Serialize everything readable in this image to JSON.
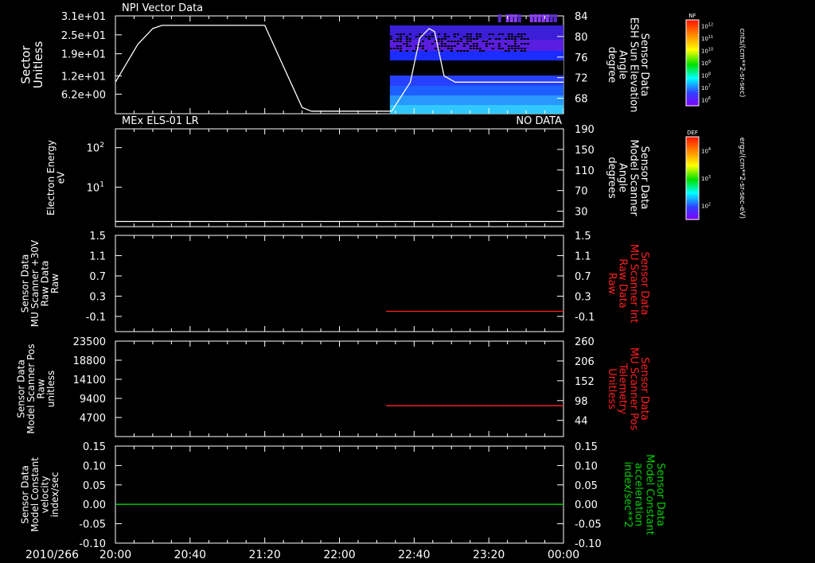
{
  "colors": {
    "background": "#000000",
    "axis": "#ffffff",
    "white_line": "#ffffff",
    "red_line": "#ff2020",
    "green_line": "#00d000",
    "red_label": "#ff2020",
    "green_label": "#00d000"
  },
  "time_axis": {
    "date_label": "2010/266",
    "ticks": [
      "20:00",
      "20:40",
      "21:20",
      "22:00",
      "22:40",
      "23:20",
      "00:00"
    ],
    "range_minutes": [
      0,
      240
    ],
    "minor_step_minutes": 10
  },
  "colorbars": [
    {
      "title": "NF",
      "unit_label": "cnts/(cm**2-sr-sec)",
      "tick_labels": [
        "10^12",
        "10^11",
        "10^10",
        "10^9",
        "10^8",
        "10^7",
        "10^6"
      ],
      "tick_mantissa": "10",
      "tick_exponents": [
        "12",
        "11",
        "10",
        "9",
        "8",
        "7",
        "6"
      ]
    },
    {
      "title": "DEF",
      "unit_label": "ergs/(cm**2-sr-sec-eV)",
      "tick_labels": [
        "10^4",
        "10^3",
        "10^2"
      ],
      "tick_mantissa": "10",
      "tick_exponents": [
        "4",
        "3",
        "2"
      ]
    }
  ],
  "chart_data": [
    {
      "type": "line",
      "title": "NPI Vector Data",
      "ylabel": "Sector\nUnitless",
      "y_ticks": [
        "3.1e+01",
        "2.5e+01",
        "1.9e+01",
        "1.2e+01",
        "6.2e+00"
      ],
      "y_tick_values": [
        31,
        25,
        19,
        12,
        6.2
      ],
      "ylim": [
        0,
        31
      ],
      "y2label": "Sensor Data\nESH Sun Elevation\nAngle\ndegree",
      "y2_ticks": [
        "84",
        "80",
        "76",
        "72",
        "68"
      ],
      "y2_tick_values": [
        84,
        80,
        76,
        72,
        68
      ],
      "y2lim": [
        65,
        84
      ],
      "series": [
        {
          "color": "white",
          "x": [
            0,
            12,
            20,
            25,
            30,
            80,
            90,
            100,
            105,
            148,
            158,
            163,
            168,
            171,
            176,
            182,
            240
          ],
          "y": [
            10,
            22,
            27,
            28,
            28,
            28,
            15,
            2,
            0.8,
            0.8,
            10,
            24,
            27,
            26,
            12,
            10,
            10
          ]
        }
      ],
      "heatmap": {
        "x_range": [
          147,
          240
        ],
        "note_rows": "spectrogram in sector channels"
      }
    },
    {
      "type": "line",
      "title": "MEx ELS-01 LR",
      "status": "NO DATA",
      "ylabel": "Electron Energy\neV",
      "y_ticks": [
        "10^2",
        "10^1"
      ],
      "y_tick_mantissa": "10",
      "y_tick_exponents": [
        "2",
        "1"
      ],
      "y_tick_values": [
        100,
        10
      ],
      "ylim": [
        1,
        300
      ],
      "log_scale": true,
      "y2label": "Sensor Data\nModel Scanner\nAngle\ndegrees",
      "y2_ticks": [
        "190",
        "150",
        "110",
        "70",
        "30"
      ],
      "y2_tick_values": [
        190,
        150,
        110,
        70,
        30
      ],
      "y2lim": [
        0,
        190
      ],
      "series": [
        {
          "color": "white",
          "axis": "y2",
          "x": [
            0,
            240
          ],
          "y": [
            10,
            10
          ]
        }
      ]
    },
    {
      "type": "line",
      "ylabel": "Sensor Data\nMU Scanner +30V\nRaw Data\nRaw",
      "y_ticks": [
        "1.5",
        "1.1",
        "0.7",
        "0.3",
        "-0.1"
      ],
      "y_tick_values": [
        1.5,
        1.1,
        0.7,
        0.3,
        -0.1
      ],
      "ylim": [
        -0.4,
        1.5
      ],
      "y2label": "Sensor Data\nMU Scanner Int\nRaw Data\nRaw",
      "y2_label_color": "red",
      "y2_ticks": [
        "1.5",
        "1.1",
        "0.7",
        "0.3",
        "-0.1"
      ],
      "y2_tick_values": [
        1.5,
        1.1,
        0.7,
        0.3,
        -0.1
      ],
      "y2lim": [
        -0.4,
        1.5
      ],
      "series": [
        {
          "color": "red",
          "axis": "y2",
          "x": [
            145,
            240
          ],
          "y": [
            0,
            0
          ]
        }
      ]
    },
    {
      "type": "line",
      "ylabel": "Sensor Data\nModel Scanner Pos\nRaw\nunitless",
      "y_ticks": [
        "23500",
        "18800",
        "14100",
        "9400",
        "4700"
      ],
      "y_tick_values": [
        23500,
        18800,
        14100,
        9400,
        4700
      ],
      "ylim": [
        0,
        23500
      ],
      "y2label": "Sensor Data\nMU Scanner Pos\nTelemetry\nUnitless",
      "y2_label_color": "red",
      "y2_ticks": [
        "260",
        "206",
        "152",
        "98",
        "44"
      ],
      "y2_tick_values": [
        260,
        206,
        152,
        98,
        44
      ],
      "y2lim": [
        0,
        260
      ],
      "series": [
        {
          "color": "red",
          "axis": "y2",
          "x": [
            145,
            240
          ],
          "y": [
            84,
            84
          ]
        }
      ]
    },
    {
      "type": "line",
      "ylabel": "Sensor Data\nModel Constant\nvelocity\nindex/sec",
      "y_ticks": [
        "0.15",
        "0.10",
        "0.05",
        "0.00",
        "-0.05",
        "-0.10"
      ],
      "y_tick_values": [
        0.15,
        0.1,
        0.05,
        0.0,
        -0.05,
        -0.1
      ],
      "ylim": [
        -0.1,
        0.15
      ],
      "y2label": "Sensor Data\nModel Constant\nacceleration\nindex/sec**2",
      "y2_label_color": "green",
      "y2_ticks": [
        "0.15",
        "0.10",
        "0.05",
        "0.00",
        "-0.05",
        "-0.10"
      ],
      "y2_tick_values": [
        0.15,
        0.1,
        0.05,
        0.0,
        -0.05,
        -0.1
      ],
      "y2lim": [
        -0.1,
        0.15
      ],
      "series": [
        {
          "color": "green",
          "axis": "y",
          "x": [
            0,
            240
          ],
          "y": [
            0,
            0
          ]
        }
      ]
    }
  ]
}
